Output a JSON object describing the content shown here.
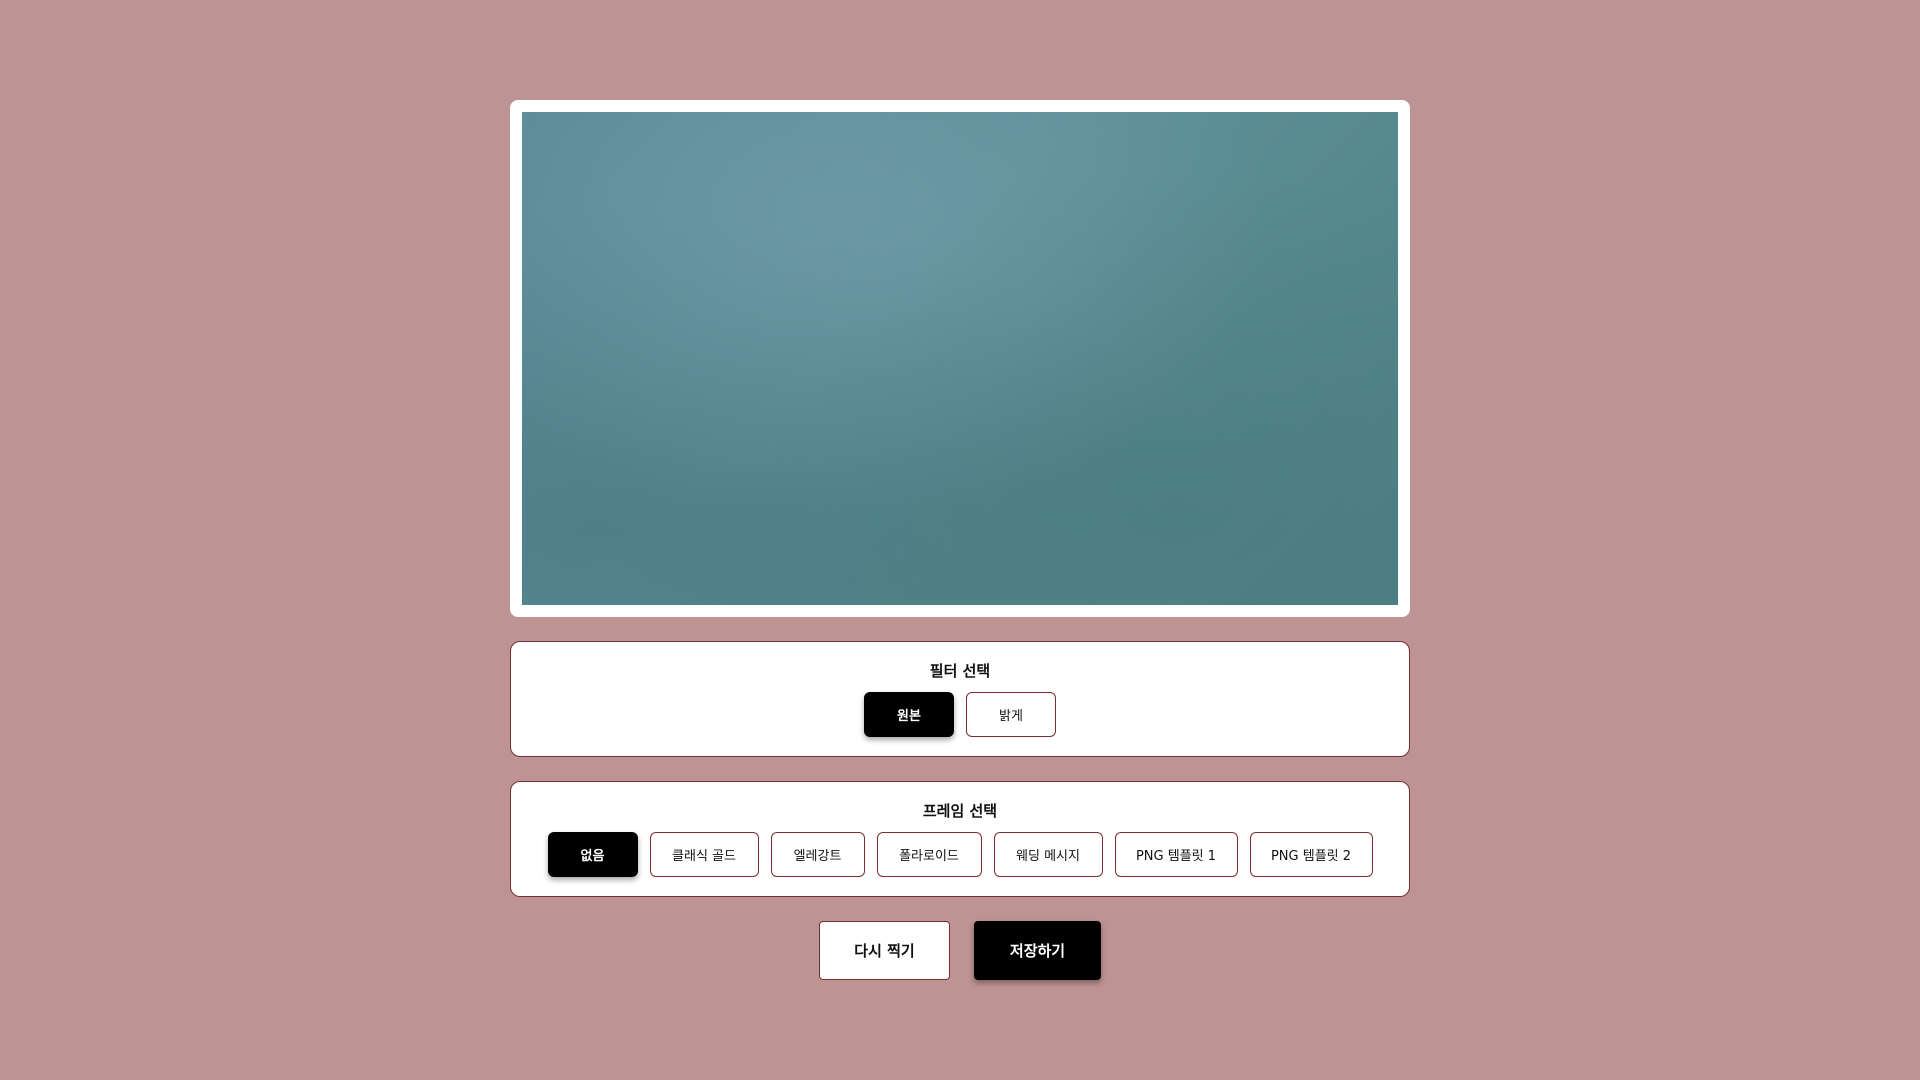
{
  "filter_panel": {
    "title": "필터 선택",
    "options": [
      {
        "label": "원본",
        "selected": true
      },
      {
        "label": "밝게",
        "selected": false
      }
    ]
  },
  "frame_panel": {
    "title": "프레임 선택",
    "options": [
      {
        "label": "없음",
        "selected": true
      },
      {
        "label": "클래식 골드",
        "selected": false
      },
      {
        "label": "엘레강트",
        "selected": false
      },
      {
        "label": "폴라로이드",
        "selected": false
      },
      {
        "label": "웨딩 메시지",
        "selected": false
      },
      {
        "label": "PNG 템플릿 1",
        "selected": false
      },
      {
        "label": "PNG 템플릿 2",
        "selected": false
      }
    ]
  },
  "actions": {
    "retake_label": "다시 찍기",
    "save_label": "저장하기"
  },
  "colors": {
    "background": "#bd9393",
    "accent_border": "#7a2e36",
    "selected": "#000000"
  }
}
